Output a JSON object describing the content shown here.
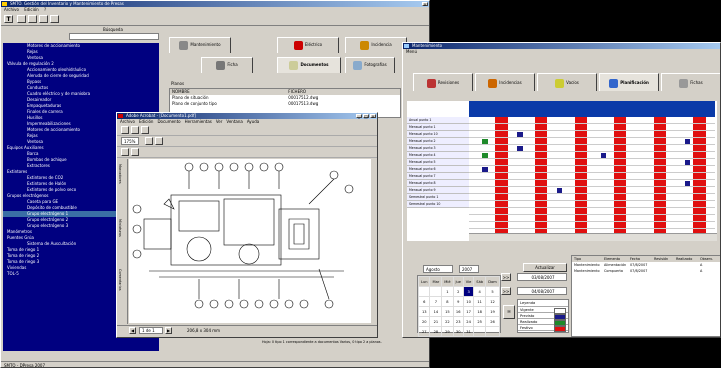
{
  "main_window": {
    "title": "SMTO. Gestión del Inventario y Mantenimiento de Presas",
    "menu": [
      "Archivo",
      "Edición",
      "?"
    ],
    "tree_title": "Búsqueda",
    "tree": [
      "Motores de accionamiento",
      "Rejas",
      "Ventosa",
      "Válvula de regulación 2",
      "Accionamiento oleohidráulico",
      "Aleruda de cierre de seguridad",
      "Bypass",
      "Conductos",
      "Cuadro eléctrico y de maniobra",
      "Desaireador",
      "Empaquetaduras",
      "Finales de carrera",
      "Husillos",
      "Impermeabilizaciones",
      "Motores de accionamiento",
      "Rejas",
      "Ventosa",
      "Equipos Auxiliares",
      "Barca",
      "Bombas de achique",
      "Extractores",
      "Extintores",
      "Extintores de CO2",
      "Extintores de Halón",
      "Extintores de polvo seco",
      "Grupos electrógenos",
      "Caseta para GE",
      "Depósito de combustible",
      "Grupo electrógeno 1",
      "Grupo electrógeno 2",
      "Grupo electrógeno 3",
      "Manómetros",
      "Puentes Grúa",
      "Sistema de Auscultación",
      "Toma de riego 1",
      "Toma de riego 2",
      "Toma de riego 3",
      "Viviendas",
      "TOL-5"
    ],
    "tabs": [
      "Mantenimiento",
      "Eléctrico",
      "Incidencia"
    ],
    "subtabs": [
      "Ficha",
      "Documentos",
      "Fotografías"
    ],
    "planos_label": "Planos",
    "planos_cols": [
      "NOMBRE",
      "FICHERO"
    ],
    "planos_rows": [
      [
        "Plano de situación",
        "00017512.dwg"
      ],
      [
        "Plano de conjunto tipo",
        "00017513.dwg"
      ]
    ],
    "status": "SMTO - DPresa 2007"
  },
  "pdf_window": {
    "title": "Adobe Acrobat - [Documento1.pdf]",
    "menu": [
      "Archivo",
      "Edición",
      "Documento",
      "Herramientas",
      "Ver",
      "Ventana",
      "Ayuda"
    ],
    "zoom": "175%",
    "page_indicator": "1 de 1",
    "page_size": "206,8 x 304 mm",
    "side_tabs": [
      "Marcadores",
      "Miniaturas",
      "Comentarios"
    ],
    "footer_note": "Hoja: 0 tipo 1 correspondiente a documentos Varios, 0 tipo 2 a planos."
  },
  "maint_window": {
    "title": "Mantenimiento",
    "menu": [
      "Menú"
    ],
    "tabs": [
      "Revisiones",
      "Incidencias",
      "Vacíos",
      "Planificación",
      "Fichas"
    ],
    "active_tab": "Planificación",
    "rows": [
      "Anual punto 1",
      "Mensual punto 1",
      "Mensual punto 10",
      "Mensual punto 2",
      "Mensual punto 3",
      "Mensual punto 4",
      "Mensual punto 5",
      "Mensual punto 6",
      "Mensual punto 7",
      "Mensual punto 8",
      "Mensual punto 9",
      "Semestral punto 1",
      "Semestral punto 10"
    ],
    "calendar": {
      "month": "Agosto",
      "year": "2007",
      "days": [
        "Lun",
        "Mar",
        "Mié",
        "Jue",
        "Vie",
        "Sáb",
        "Dom"
      ],
      "weeks": [
        [
          "",
          "",
          "1",
          "2",
          "3",
          "4",
          "5"
        ],
        [
          "6",
          "7",
          "8",
          "9",
          "10",
          "11",
          "12"
        ],
        [
          "13",
          "14",
          "15",
          "16",
          "17",
          "18",
          "19"
        ],
        [
          "20",
          "21",
          "22",
          "23",
          "24",
          "25",
          "26"
        ],
        [
          "27",
          "28",
          "29",
          "30",
          "31",
          "",
          ""
        ]
      ],
      "selected": "3"
    },
    "actualizar_label": "Actualizar",
    "date1": "03/08/2007",
    "date2": "04/08/2007",
    "legend_title": "Leyenda",
    "legend": [
      {
        "label": "Vigente",
        "color": "#ffffff"
      },
      {
        "label": "Previsto",
        "color": "#1a1a8a"
      },
      {
        "label": "Realizado",
        "color": "#1e8a2a"
      },
      {
        "label": "Festivo",
        "color": "#e01010"
      }
    ],
    "table_cols": [
      "Tipo",
      "Elemento",
      "Fecha",
      "Revisión",
      "Realizado",
      "Observ."
    ],
    "table_rows": [
      [
        "Mantenimiento",
        "Alimentación",
        "07/8/2007",
        "",
        "",
        "A"
      ],
      [
        "Mantenimiento",
        "Compuerta",
        "07/8/2007",
        "",
        "",
        "A"
      ]
    ],
    "colors": {
      "festivo": "#e01010",
      "previsto": "#1a1a8a",
      "realizado": "#1e8a2a"
    },
    "festivo_cols": [
      6,
      7,
      15,
      16,
      24,
      25,
      33,
      34,
      42,
      43,
      51,
      52
    ],
    "marks": [
      {
        "row": 3,
        "col": 3,
        "kind": "realizado"
      },
      {
        "row": 5,
        "col": 3,
        "kind": "realizado"
      },
      {
        "row": 7,
        "col": 3,
        "kind": "previsto"
      },
      {
        "row": 2,
        "col": 11,
        "kind": "previsto"
      },
      {
        "row": 4,
        "col": 11,
        "kind": "previsto"
      },
      {
        "row": 5,
        "col": 30,
        "kind": "previsto"
      },
      {
        "row": 10,
        "col": 20,
        "kind": "previsto"
      },
      {
        "row": 6,
        "col": 49,
        "kind": "previsto"
      },
      {
        "row": 9,
        "col": 49,
        "kind": "previsto"
      },
      {
        "row": 3,
        "col": 49,
        "kind": "previsto"
      }
    ]
  }
}
